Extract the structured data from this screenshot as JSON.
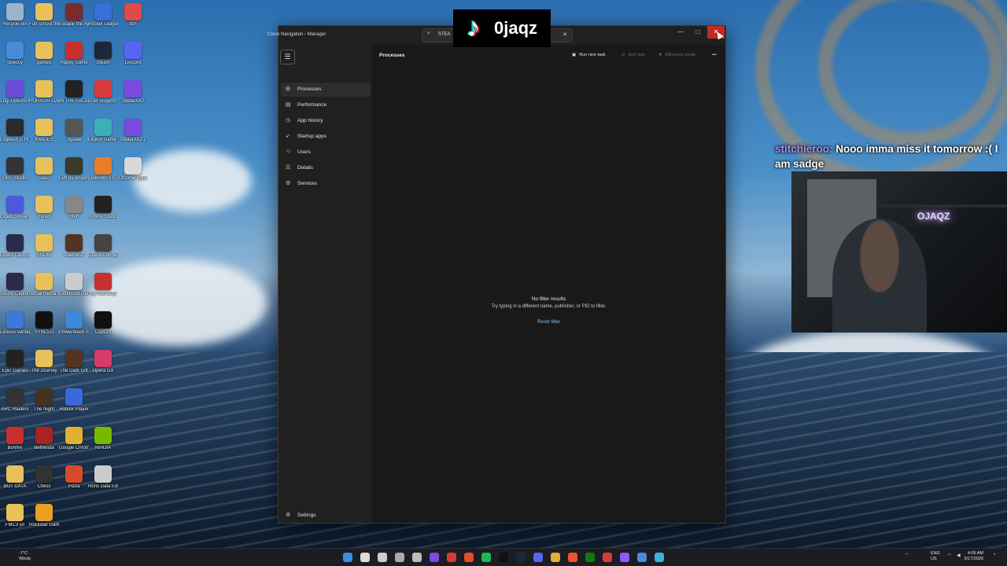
{
  "overlay": {
    "tiktok_handle": "0jaqz",
    "chat_user": "stitchieroo:",
    "chat_message": "Nooo imma miss it tomorrow :( I am sadge",
    "neon_sign": "OJAQZ"
  },
  "window": {
    "title": "Close Navigation ‹ Manager",
    "search_value": "STEA",
    "controls": {
      "minimize": "—",
      "maximize": "□",
      "close": "✕"
    }
  },
  "nav": {
    "hamburger": "☰",
    "items": [
      {
        "label": "Processes",
        "icon": "processes-icon",
        "glyph": "⊞"
      },
      {
        "label": "Performance",
        "icon": "performance-icon",
        "glyph": "▤"
      },
      {
        "label": "App history",
        "icon": "app-history-icon",
        "glyph": "◷"
      },
      {
        "label": "Startup apps",
        "icon": "startup-icon",
        "glyph": "➶"
      },
      {
        "label": "Users",
        "icon": "users-icon",
        "glyph": "☺"
      },
      {
        "label": "Details",
        "icon": "details-icon",
        "glyph": "☰"
      },
      {
        "label": "Services",
        "icon": "services-icon",
        "glyph": "⚙"
      }
    ],
    "settings": {
      "label": "Settings",
      "glyph": "⚙"
    }
  },
  "main": {
    "page_title": "Processes",
    "toolbar": {
      "run_new_task": "Run new task",
      "end_task": "End task",
      "efficiency_mode": "Efficiency mode",
      "more": "•••"
    },
    "empty_title": "No filter results",
    "empty_hint": "Try typing in a different name, publisher, or PID to filter.",
    "reset_filter": "Reset filter"
  },
  "desktop_icons": [
    {
      "label": "Recycle Bin",
      "color": "#9ab4c8"
    },
    {
      "label": "Fun school things",
      "color": "#e8c15a"
    },
    {
      "label": "Escape the Ayuvok",
      "color": "#7a2b2b"
    },
    {
      "label": "Rocket League",
      "color": "#3a6fd8"
    },
    {
      "label": "itch",
      "color": "#e04a4a"
    },
    {
      "label": "Speccy",
      "color": "#4a8ad8"
    },
    {
      "label": "games",
      "color": "#e8c15a"
    },
    {
      "label": "Happy Game",
      "color": "#c83030"
    },
    {
      "label": "Steam",
      "color": "#1b2838"
    },
    {
      "label": "Discord",
      "color": "#5865f2"
    },
    {
      "label": "Logi Options+",
      "color": "#6c4ad8"
    },
    {
      "label": "HORROR GAMES",
      "color": "#e8c15a"
    },
    {
      "label": "IN THE FACADE",
      "color": "#222222"
    },
    {
      "label": "Get Support",
      "color": "#d83a3a"
    },
    {
      "label": "StellarAIO",
      "color": "#7b4ae0"
    },
    {
      "label": "Logitech G HUB",
      "color": "#2a2a2a"
    },
    {
      "label": "IMAGES",
      "color": "#e8c15a"
    },
    {
      "label": "Jigsaw",
      "color": "#555555"
    },
    {
      "label": "Legion Game Shop",
      "color": "#3ab0b8"
    },
    {
      "label": "StellarAIO-1",
      "color": "#7b4ae0"
    },
    {
      "label": "OBS Studio",
      "color": "#333333"
    },
    {
      "label": "uuuu",
      "color": "#e8c15a"
    },
    {
      "label": "Left By Angels",
      "color": "#3a3a2a"
    },
    {
      "label": "Blender 3.0",
      "color": "#e87d2a"
    },
    {
      "label": "Chrome Apps",
      "color": "#d8d8d8"
    },
    {
      "label": "Elgato Stream Deck",
      "color": "#4a5ad8"
    },
    {
      "label": "music",
      "color": "#e8c15a"
    },
    {
      "label": "Stuff",
      "color": "#888888"
    },
    {
      "label": "Roblox Studio",
      "color": "#222222"
    },
    {
      "label": "Elgato Capture",
      "color": "#2a2a4a"
    },
    {
      "label": "SNOW",
      "color": "#e8c15a"
    },
    {
      "label": "Madness",
      "color": "#553322"
    },
    {
      "label": "Opera Connect",
      "color": "#444444"
    },
    {
      "label": "Sound Capture",
      "color": "#2a2a4a"
    },
    {
      "label": "Social media stuff",
      "color": "#e8c15a"
    },
    {
      "label": "Outbound Demo",
      "color": "#cccccc"
    },
    {
      "label": "My Warranty",
      "color": "#c83030"
    },
    {
      "label": "Lenovo Vantage",
      "color": "#3a7ad8"
    },
    {
      "label": "SYNCED",
      "color": "#111111"
    },
    {
      "label": "PowerWash Simulator",
      "color": "#3a8ad8"
    },
    {
      "label": "CapCut",
      "color": "#111111"
    },
    {
      "label": "Epic Games",
      "color": "#222222"
    },
    {
      "label": "The Journey",
      "color": "#e8c15a"
    },
    {
      "label": "The Dark Gift",
      "color": "#553322"
    },
    {
      "label": "Opera GX",
      "color": "#d83a6a"
    },
    {
      "label": "ARC Raiders",
      "color": "#333333"
    },
    {
      "label": "The Night",
      "color": "#443322"
    },
    {
      "label": "Roblox Player",
      "color": "#3a6ad8"
    },
    {
      "label": "Bonfire",
      "color": "#c83030"
    },
    {
      "label": "Bethesda",
      "color": "#aa2222"
    },
    {
      "label": "Google Chrome",
      "color": "#e0b030"
    },
    {
      "label": "NVIDIA",
      "color": "#76b900"
    },
    {
      "label": "BOT DATA",
      "color": "#e8c15a"
    },
    {
      "label": "Chess",
      "color": "#333333"
    },
    {
      "label": "Pizza",
      "color": "#d84a2a"
    },
    {
      "label": "Rons Data Edit",
      "color": "#cccccc"
    },
    {
      "label": "FMC3 yo",
      "color": "#e8c15a"
    },
    {
      "label": "Rockstar Games",
      "color": "#e8a020"
    }
  ],
  "taskbar": {
    "weather_temp": "-7°C",
    "weather_desc": "Windy",
    "lang": "ENG",
    "region": "US",
    "time": "4:05 AM",
    "date": "3/17/2026"
  }
}
